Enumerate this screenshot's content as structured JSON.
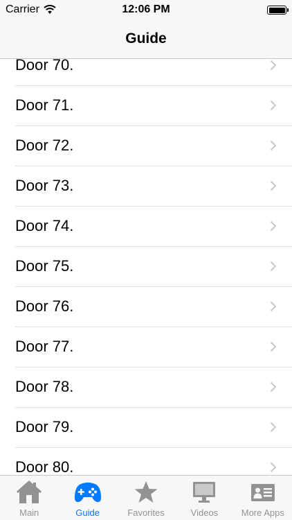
{
  "status_bar": {
    "carrier": "Carrier",
    "time": "12:06 PM"
  },
  "nav": {
    "title": "Guide"
  },
  "list": {
    "items": [
      {
        "label": "Door 70."
      },
      {
        "label": "Door 71."
      },
      {
        "label": "Door 72."
      },
      {
        "label": "Door 73."
      },
      {
        "label": "Door 74."
      },
      {
        "label": "Door 75."
      },
      {
        "label": "Door 76."
      },
      {
        "label": "Door 77."
      },
      {
        "label": "Door 78."
      },
      {
        "label": "Door 79."
      },
      {
        "label": "Door 80."
      }
    ]
  },
  "tab_bar": {
    "tabs": [
      {
        "label": "Main",
        "icon": "house-icon",
        "active": false
      },
      {
        "label": "Guide",
        "icon": "gamepad-icon",
        "active": true
      },
      {
        "label": "Favorites",
        "icon": "star-icon",
        "active": false
      },
      {
        "label": "Videos",
        "icon": "monitor-icon",
        "active": false
      },
      {
        "label": "More Apps",
        "icon": "contact-card-icon",
        "active": false
      }
    ]
  },
  "colors": {
    "accent": "#007aff",
    "inactive_tab": "#929292",
    "bar_background": "#f7f7f7",
    "separator": "#e0e0e4",
    "chevron": "#c7c7cc"
  }
}
